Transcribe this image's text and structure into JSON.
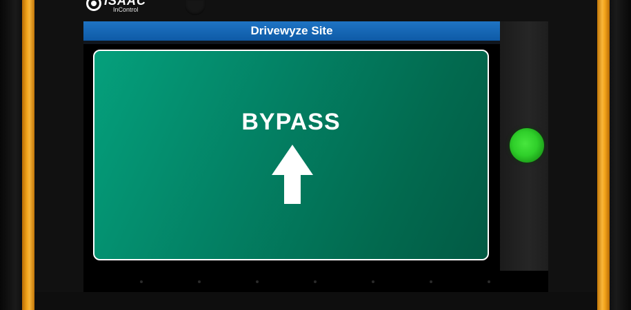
{
  "logo": {
    "brand": "ISAAC",
    "sub": "InControl"
  },
  "header": {
    "title": "Drivewyze Site"
  },
  "sign": {
    "message": "BYPASS",
    "arrow": "up-arrow-icon"
  },
  "status_light": {
    "color": "#2fcf2a",
    "state": "green"
  },
  "colors": {
    "housing_accent": "#f4a51c",
    "titlebar": "#1f74c4",
    "sign_background": "#038265"
  }
}
